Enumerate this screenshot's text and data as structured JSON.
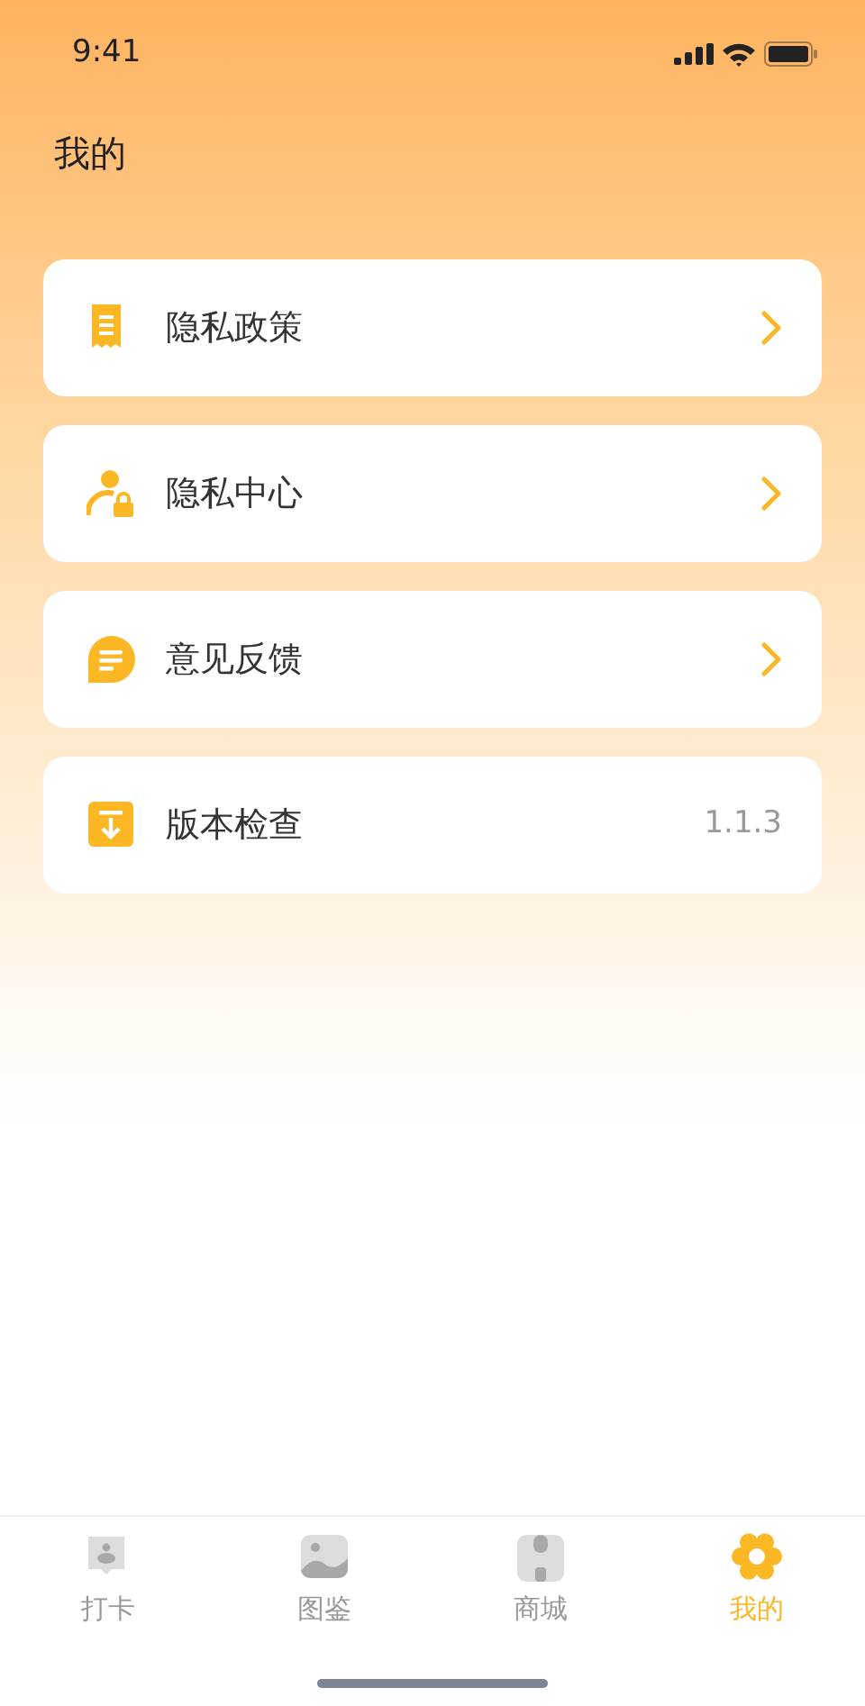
{
  "status_bar": {
    "time": "9:41"
  },
  "title": "我的",
  "menu": [
    {
      "kind": "link",
      "label": "隐私政策"
    },
    {
      "kind": "link",
      "label": "隐私中心"
    },
    {
      "kind": "link",
      "label": "意见反馈"
    },
    {
      "kind": "value",
      "label": "版本检查",
      "value": "1.1.3"
    }
  ],
  "tab_bar": [
    {
      "label": "打卡",
      "selected": false
    },
    {
      "label": "图鉴",
      "selected": false
    },
    {
      "label": "商城",
      "selected": false
    },
    {
      "label": "我的",
      "selected": true
    }
  ]
}
